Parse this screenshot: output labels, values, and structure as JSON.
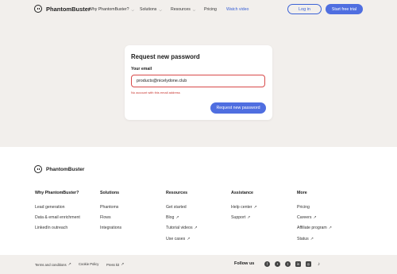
{
  "brand": {
    "name": "PhantomBuster"
  },
  "nav": {
    "why": "Why PhantomBuster?",
    "solutions": "Solutions",
    "resources": "Resources",
    "pricing": "Pricing",
    "watch_video": "Watch video",
    "login": "Log in",
    "trial": "Start free trial"
  },
  "form": {
    "title": "Request new password",
    "email_label": "Your email",
    "email_value": "products@nicelydone.club",
    "error": "No account with this email address",
    "submit": "Request new password"
  },
  "footer": {
    "columns": [
      {
        "title": "Why PhantomBuster?",
        "links": [
          "Lead generation",
          "Data & email enrichment",
          "LinkedIn outreach"
        ]
      },
      {
        "title": "Solutions",
        "links": [
          "Phantoms",
          "Flows",
          "Integrations"
        ]
      },
      {
        "title": "Resources",
        "links": [
          "Get started",
          "Blog",
          "Tutorial videos",
          "Use cases"
        ]
      },
      {
        "title": "Assistance",
        "links": [
          "Help center",
          "Support"
        ]
      },
      {
        "title": "More",
        "links": [
          "Pricing",
          "Careers",
          "Affiliate program",
          "Status"
        ]
      }
    ],
    "legal": {
      "terms": "Terms and conditions",
      "cookie": "Cookie Policy",
      "press": "Press kit"
    },
    "follow_us": "Follow us",
    "social_icons": [
      "facebook-icon",
      "reddit-icon",
      "twitter-icon",
      "linkedin-icon",
      "instagram-icon",
      "tiktok-icon"
    ]
  },
  "colors": {
    "accent": "#4f6ee0",
    "error": "#c8352f",
    "background": "#f2efec"
  }
}
